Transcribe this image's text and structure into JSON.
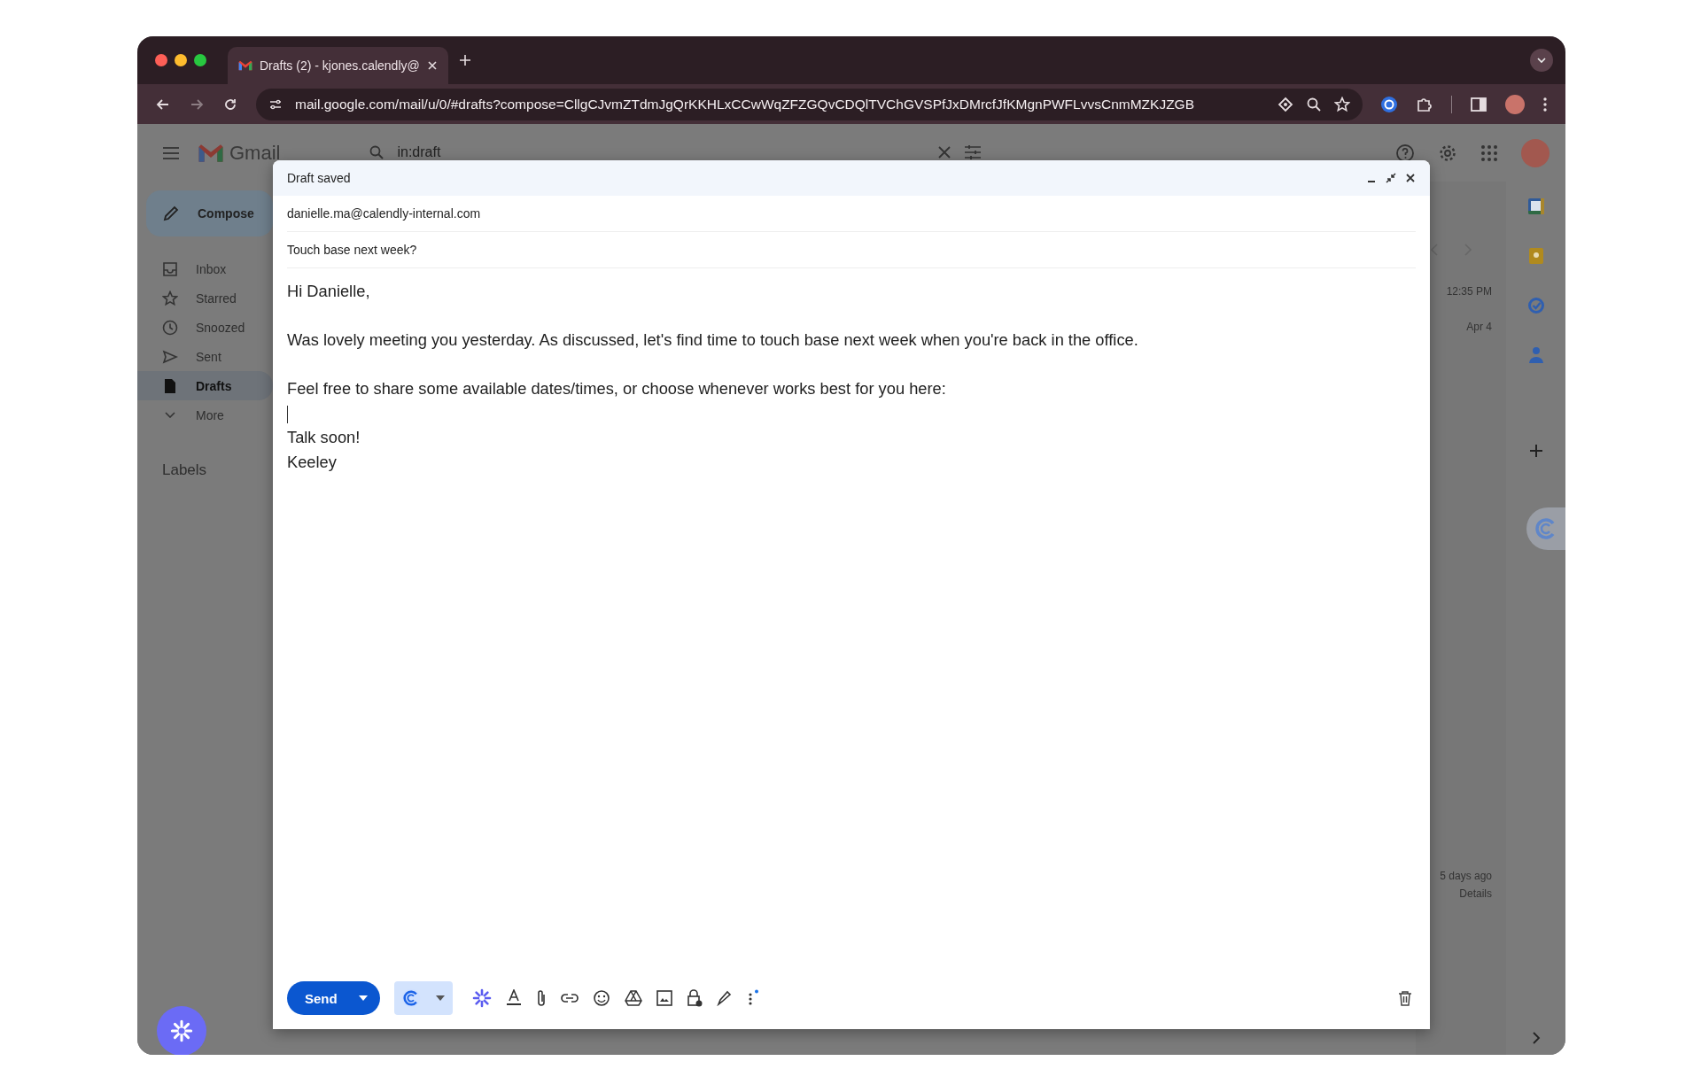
{
  "browser": {
    "tab": {
      "title": "Drafts (2) - kjones.calendly@"
    },
    "url": "mail.google.com/mail/u/0/#drafts?compose=CllgCJvmZTdmJgQrKKHLxCCwWqZFZGQvCDQlTVChGVSPfJxDMrcfJfKMgnPWFLvvsCnmMZKJZGB"
  },
  "gmail": {
    "app_name": "Gmail",
    "search": {
      "value": "in:draft"
    },
    "compose_button": "Compose",
    "sidebar": {
      "items": [
        {
          "label": "Inbox",
          "selected": false
        },
        {
          "label": "Starred",
          "selected": false
        },
        {
          "label": "Snoozed",
          "selected": false
        },
        {
          "label": "Sent",
          "selected": false
        },
        {
          "label": "Drafts",
          "selected": true
        },
        {
          "label": "More",
          "selected": false
        }
      ],
      "labels_heading": "Labels"
    },
    "list": {
      "times": [
        "12:35 PM",
        "Apr 4"
      ],
      "activity": "5 days ago",
      "details_link": "Details"
    }
  },
  "compose": {
    "status": "Draft saved",
    "to": "danielle.ma@calendly-internal.com",
    "subject": "Touch base next week?",
    "body": [
      {
        "kind": "text",
        "text": "Hi Danielle,"
      },
      {
        "kind": "blank"
      },
      {
        "kind": "text",
        "text": "Was lovely meeting you yesterday. As discussed, let's find time to touch base next week when you're back in the office."
      },
      {
        "kind": "blank"
      },
      {
        "kind": "text",
        "text": "Feel free to share some available dates/times, or choose whenever works best for you here:"
      },
      {
        "kind": "cursor"
      },
      {
        "kind": "text",
        "text": "Talk soon!"
      },
      {
        "kind": "text",
        "text": "Keeley"
      }
    ],
    "send_button": "Send"
  }
}
